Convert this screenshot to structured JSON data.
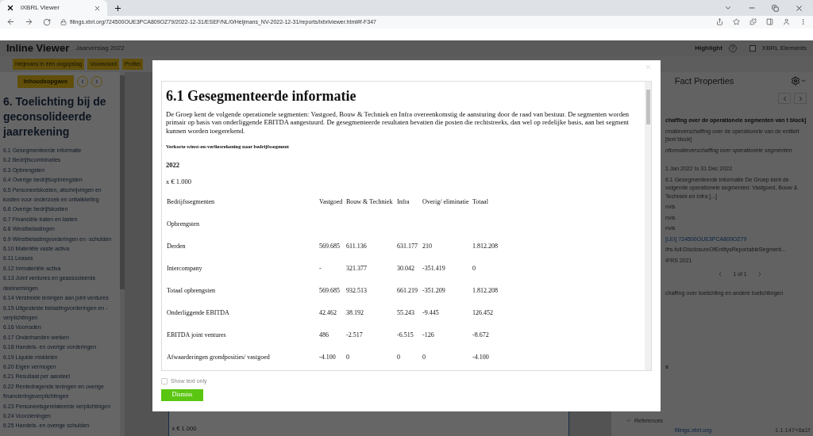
{
  "browser": {
    "tab_title": "iXBRL Viewer",
    "url": "filings.xbrl.org/724500OUE3PCA809OZ79/2022-12-31/ESEF/NL/0/Heijmans_NV-2022-12-31/reports/ixbrlviewer.html#f-F347"
  },
  "app": {
    "title": "Inline Viewer",
    "subtitle": "Jaarverslag 2022",
    "highlight_label": "Highlight",
    "help": "?",
    "xbrl_elements": {
      "label": "XBRL Elements",
      "checked": false
    }
  },
  "nav_buttons": [
    "Heijmans in één oogopslag",
    "Voorwoord",
    "Profiel"
  ],
  "toc": {
    "button": "Inhoudsopgave",
    "heading": "6. Toelichting bij de geconsolideerde jaarrekening",
    "items": [
      "6.1 Gesegmenteerde informatie",
      "6.2 Bedrijfscombinaties",
      "6.3 Opbrengsten",
      "6.4 Overige bedrijfsopbrengsten",
      "6.5 Personeelskosten, afschrijvingen en kosten voor onderzoek en ontwikkeling",
      "6.6 Overige bedrijfskosten",
      "6.7 Financiële baten en lasten",
      "6.8 Winstbelastingen",
      "6.9 Winstbelastingvorderingen en -schulden",
      "6.10 Materiële vaste activa",
      "6.11 Leases",
      "6.12 Immateriële activa",
      "6.13 Joint ventures en geassocieerde deelnemingen",
      "6.14 Verstrekte leningen aan joint ventures",
      "6.15 Uitgestelde belastingvorderingen en -verplichtingen",
      "6.16 Voorraden",
      "6.17 Onderhanden werken",
      "6.18 Handels- en overige vorderingen",
      "6.19 Liquide middelen",
      "6.20 Eigen vermogen",
      "6.21 Resultaat per aandeel",
      "6.22 Rentedragende leningen en overige financieringsverplichtingen",
      "6.23 Personeelsgerelateerde verplichtingen",
      "6.24 Voorzieningen",
      "6.25 Handels- en overige schulden"
    ]
  },
  "document_footer": "x € 1.000",
  "fact_panel": {
    "title": "Fact Properties",
    "concept": "chaffing over de operationele segmenten van t block]",
    "lines": [
      {
        "kind": "plain",
        "text": "rmatieverschaffing over de operationele van de entiteit [text block]"
      },
      {
        "kind": "italic",
        "text": "nformatieverschaffing over operationele segmenten"
      },
      {
        "kind": "plain",
        "text": "1 Jan 2022 to 31 Dec 2022"
      },
      {
        "kind": "plain",
        "text": "6.1 Gesegmenteerde informatie De Groep kent de volgende operationele segmenten: Vastgoed, Bouw & Techniek en Infra [...]"
      },
      {
        "kind": "plain",
        "text": "nvis"
      },
      {
        "kind": "plain",
        "text": "nvis"
      },
      {
        "kind": "plain",
        "text": "nvis"
      },
      {
        "kind": "link",
        "text": "[LEI] 724500OUE3PCA809OZ79"
      },
      {
        "kind": "plain",
        "text": "ifrs-full:DisclosureOfEntitysReportableSegment..."
      },
      {
        "kind": "plain",
        "text": "IFRS 2021"
      }
    ],
    "pager": "1 of 1",
    "section": "chaffing over toelichting en andere toelichtingen",
    "heading_tail": "s",
    "references": "References"
  },
  "status": {
    "host": "filings.xbrl.org",
    "version": "1.1.147+6a1f"
  },
  "modal": {
    "heading": "6.1 Gesegmenteerde informatie",
    "paragraph": "De Groep kent de volgende operationele segmenten: Vastgoed, Bouw & Techniek en Infra overeenkomstig de aansturing door de raad van bestuur. De segmenten worden primair op basis van onderliggende EBITDA aangestuurd. De gesegmenteerde resultaten bevatten die posten die rechtstreeks, dan wel op redelijke basis, aan het segment kunnen worden toegerekend.",
    "caption": "Verkorte winst-en-verliesrekening naar bedrijfssegment",
    "year": "2022",
    "unit": "x € 1.000",
    "columns": [
      "Bedrijfssegmenten",
      "Vastgoed",
      "Bouw & Techniek",
      "Infra",
      "Overig/ eliminatie",
      "Totaal"
    ],
    "rows": [
      [
        "Opbrengsten",
        "",
        "",
        "",
        "",
        ""
      ],
      [
        "Derden",
        "569.685",
        "611.136",
        "631.177",
        "210",
        "1.812.208"
      ],
      [
        "Intercompany",
        "-",
        "321.377",
        "30.042",
        "-351.419",
        "0"
      ],
      [
        "Totaal opbrengsten",
        "569.685",
        "932.513",
        "661.219",
        "-351.209",
        "1.812.208"
      ],
      [
        "Onderliggende EBITDA",
        "42.462",
        "38.192",
        "55.243",
        "-9.445",
        "126.452"
      ],
      [
        "EBITDA joint ventures",
        "486",
        "-2.517",
        "-6.515",
        "-126",
        "-8.672"
      ],
      [
        "Afwaarderingen grondposities/ vastgoed",
        "-4.100",
        "0",
        "0",
        "0",
        "-4.100"
      ]
    ],
    "show_text_only": {
      "label": "Show text only",
      "checked": false
    },
    "dismiss": "Dismiss"
  }
}
